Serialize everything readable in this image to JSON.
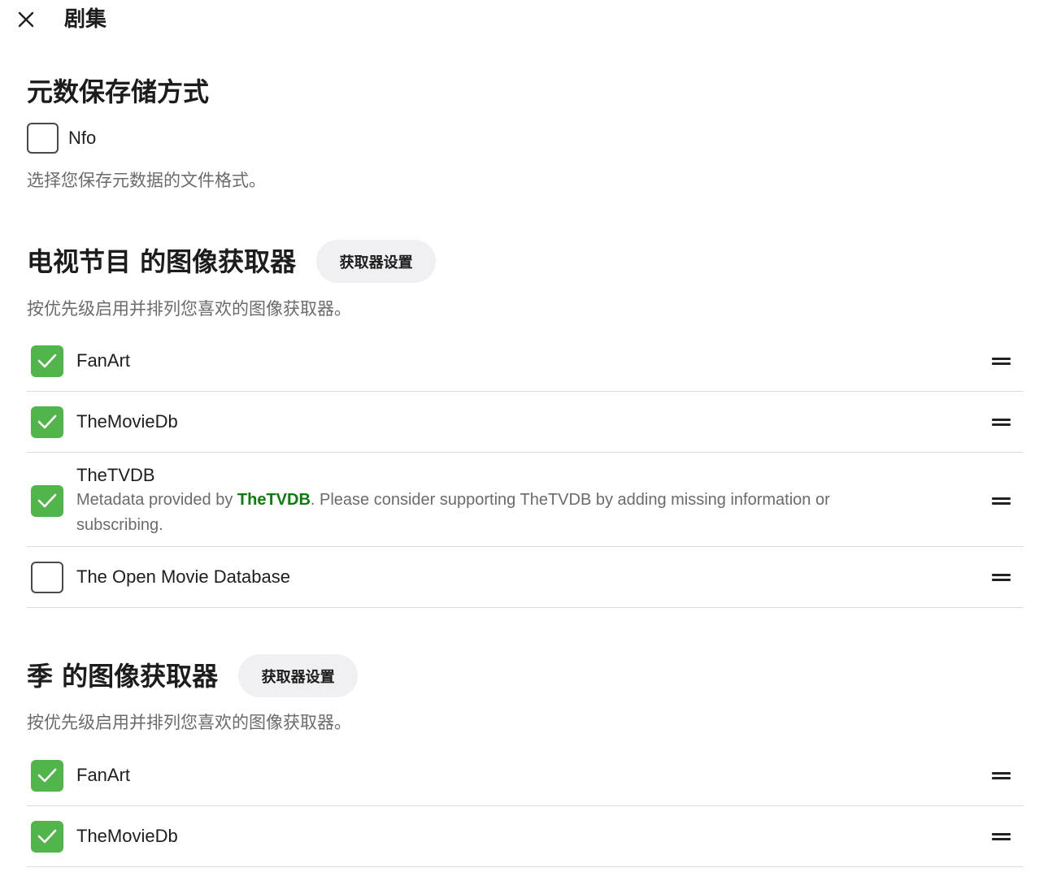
{
  "header": {
    "title": "剧集",
    "close_icon": "close-icon"
  },
  "metadata_savers": {
    "heading": "元数保存储方式",
    "options": [
      {
        "label": "Nfo",
        "checked": false
      }
    ],
    "description": "选择您保存元数据的文件格式。"
  },
  "series_image_fetchers": {
    "heading": "电视节目 的图像获取器",
    "settings_button": "获取器设置",
    "description": "按优先级启用并排列您喜欢的图像获取器。",
    "items": [
      {
        "label": "FanArt",
        "checked": true
      },
      {
        "label": "TheMovieDb",
        "checked": true
      },
      {
        "label": "TheTVDB",
        "checked": true,
        "note_prefix": "Metadata provided by ",
        "note_link": "TheTVDB",
        "note_suffix": ". Please consider supporting TheTVDB by adding missing information or subscribing."
      },
      {
        "label": "The Open Movie Database",
        "checked": false
      }
    ]
  },
  "season_image_fetchers": {
    "heading": "季 的图像获取器",
    "settings_button": "获取器设置",
    "description": "按优先级启用并排列您喜欢的图像获取器。",
    "items": [
      {
        "label": "FanArt",
        "checked": true
      },
      {
        "label": "TheMovieDb",
        "checked": true
      }
    ]
  },
  "icons": {
    "close": "close-icon",
    "check": "check-icon",
    "drag": "drag-handle-icon"
  },
  "colors": {
    "accent_green": "#52b54b",
    "link_green": "#0b7d0b"
  }
}
